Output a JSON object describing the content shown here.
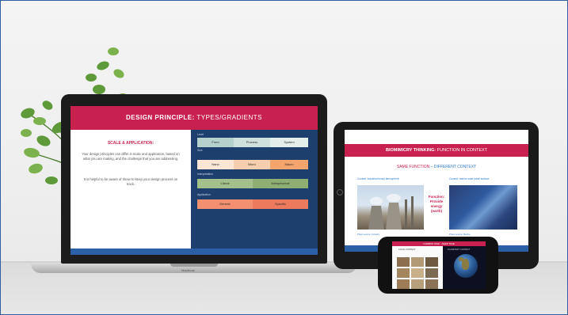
{
  "laptop": {
    "header_bold": "DESIGN PRINCIPLE:",
    "header_thin": " TYPES/GRADIENTS",
    "subtitle": "SCALE & APPLICATION:",
    "para1": "Your design principles can differ in scale and application, based on what you are making, and the challenge that you are addressing.",
    "para2": "It is helpful to be aware of these to keep your design process on track.",
    "row1_label": "Level",
    "row1": [
      "Form",
      "Process",
      "System"
    ],
    "row2_label": "Size",
    "row2": [
      "Nano",
      "Micro",
      "Macro"
    ],
    "row3_label": "Interpretation",
    "row3": [
      "Literal",
      "Metaphorical"
    ],
    "row4_label": "Application",
    "row4": [
      "Generic",
      "Specific"
    ],
    "brand": "MacBook"
  },
  "tablet": {
    "header_bold": "BIOMIMICRY THINKING:",
    "header_thin": " FUNCTION IN CONTEXT",
    "subtitle_red": "SAME FUNCTION",
    "subtitle_blue": " – DIFFERENT CONTEXT",
    "context_left": "Context: industrial heavy atmosphere",
    "context_right": "Context: marine solar panel surface",
    "middle": [
      "Function:",
      "Provide",
      "energy",
      "(earth)"
    ],
    "cap_left": "Photo source: Industry",
    "cap_right": "Photo source: Marine"
  },
  "phone": {
    "header": "CARBON SINK · DEEP TIME",
    "left_label": "LOCAL CONTEXT",
    "right_label": "PLANETARY CONTEXT"
  }
}
